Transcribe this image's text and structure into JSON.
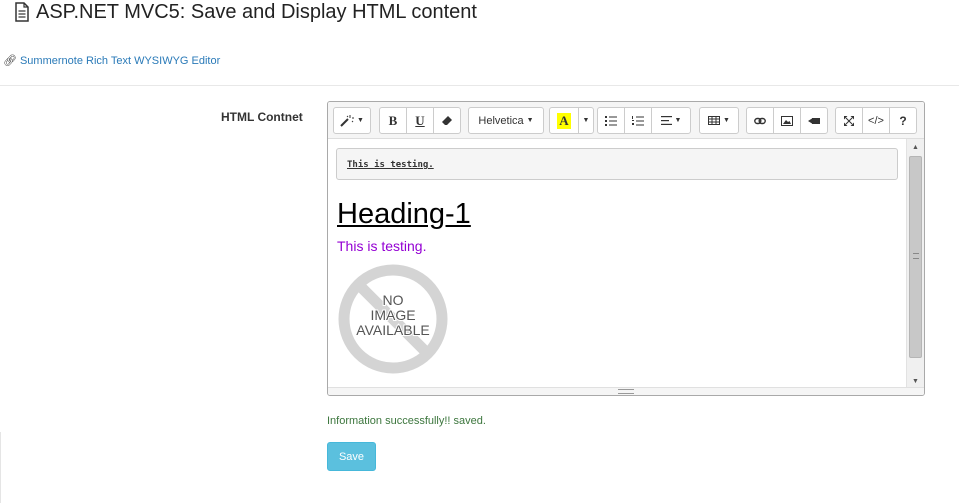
{
  "page": {
    "title": "ASP.NET MVC5: Save and Display HTML content",
    "link_text": "Summernote Rich Text WYSIWYG Editor",
    "icons": {
      "title": "document-icon",
      "link": "link-icon"
    }
  },
  "form": {
    "label": "HTML Contnet",
    "success_message": "Information successfully!! saved.",
    "save_label": "Save"
  },
  "editor": {
    "toolbar": {
      "font_name": "Helvetica",
      "bold": "B",
      "underline": "U",
      "color_letter": "A",
      "code_view": "</>",
      "help": "?",
      "icons": [
        "magic-wand-icon",
        "bold-icon",
        "underline-icon",
        "eraser-icon",
        "font-family-dropdown",
        "color-icon",
        "unordered-list-icon",
        "ordered-list-icon",
        "paragraph-align-icon",
        "table-icon",
        "link-icon",
        "picture-icon",
        "video-icon",
        "fullscreen-icon",
        "code-view-icon",
        "help-icon"
      ]
    },
    "content": {
      "code_text": "This is testing.",
      "heading": "Heading-1",
      "paragraph": "This is testing.",
      "placeholder_image_text": [
        "NO",
        "IMAGE",
        "AVAILABLE"
      ]
    }
  },
  "colors": {
    "link": "#2a7ab8",
    "paragraph_purple": "#9400d3",
    "success_green": "#3c763d",
    "save_button": "#5bc0de",
    "highlight_yellow": "#ffff00"
  }
}
